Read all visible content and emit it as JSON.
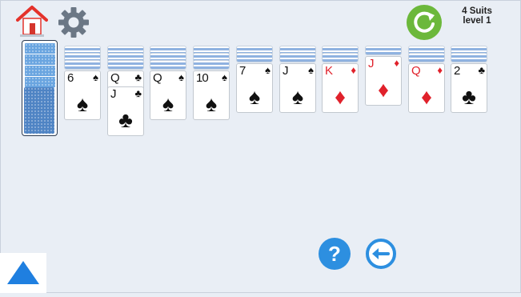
{
  "header": {
    "suits_label": "4 Suits",
    "level_label": "level 1"
  },
  "icons": {
    "home": "home-icon",
    "settings": "gear-icon",
    "restart": "reload-icon",
    "help": "question-icon",
    "undo": "back-arrow-icon",
    "menu": "triangle-up-icon"
  },
  "buttons": {
    "help_label": "?"
  },
  "colors": {
    "background": "#e9eef5",
    "restart_green": "#6cb83b",
    "help_blue": "#2d8fe0",
    "card_red": "#e0212b",
    "card_back_blue": "#6aa5e0"
  },
  "stock": {
    "icon": "card-back-stack"
  },
  "tableau": [
    {
      "hidden": 3,
      "cards": [
        {
          "rank": "6",
          "suit": "♠",
          "color": "black"
        }
      ]
    },
    {
      "hidden": 3,
      "cards": [
        {
          "rank": "Q",
          "suit": "♣",
          "color": "black"
        },
        {
          "rank": "J",
          "suit": "♣",
          "color": "black"
        }
      ]
    },
    {
      "hidden": 3,
      "cards": [
        {
          "rank": "Q",
          "suit": "♠",
          "color": "black"
        }
      ]
    },
    {
      "hidden": 3,
      "cards": [
        {
          "rank": "10",
          "suit": "♠",
          "color": "black"
        }
      ]
    },
    {
      "hidden": 2,
      "cards": [
        {
          "rank": "7",
          "suit": "♠",
          "color": "black"
        }
      ]
    },
    {
      "hidden": 2,
      "cards": [
        {
          "rank": "J",
          "suit": "♠",
          "color": "black"
        }
      ]
    },
    {
      "hidden": 2,
      "cards": [
        {
          "rank": "K",
          "suit": "♦",
          "color": "red"
        }
      ]
    },
    {
      "hidden": 1,
      "cards": [
        {
          "rank": "J",
          "suit": "♦",
          "color": "red"
        }
      ]
    },
    {
      "hidden": 2,
      "cards": [
        {
          "rank": "Q",
          "suit": "♦",
          "color": "red"
        }
      ]
    },
    {
      "hidden": 2,
      "cards": [
        {
          "rank": "2",
          "suit": "♣",
          "color": "black"
        }
      ]
    }
  ]
}
